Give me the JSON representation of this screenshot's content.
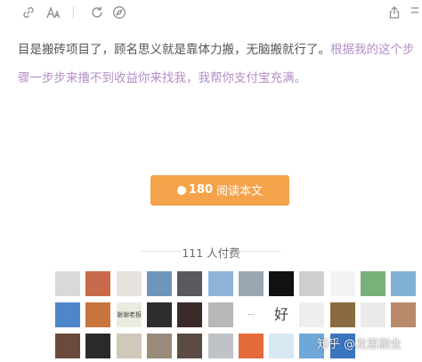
{
  "toolbar": {
    "icons": [
      {
        "name": "link-icon"
      },
      {
        "name": "font-size-icon"
      },
      {
        "name": "refresh-icon"
      },
      {
        "name": "compass-icon"
      },
      {
        "name": "share-icon"
      },
      {
        "name": "more-icon"
      }
    ]
  },
  "article": {
    "line1_text": "目是搬砖项目了，顾名思义就是靠体力搬，无脑搬就行了。",
    "line1_link": "根据我的这个步",
    "line2_link": "骤一步步来撸不到收益你来找我，我帮你支付宝充满。"
  },
  "read_button": {
    "count": "180",
    "label": "阅读本文"
  },
  "payers": {
    "label": "111 人付费"
  },
  "avatars": [
    {
      "bg": "#d9d9d9",
      "text": ""
    },
    {
      "bg": "#c86a4a",
      "text": ""
    },
    {
      "bg": "#e8e2dc",
      "text": ""
    },
    {
      "bg": "#6e96b8",
      "text": ""
    },
    {
      "bg": "#585a5e",
      "text": ""
    },
    {
      "bg": "#8fb4d8",
      "text": ""
    },
    {
      "bg": "#9aa7b2",
      "text": ""
    },
    {
      "bg": "#111111",
      "text": ""
    },
    {
      "bg": "#cfcfcf",
      "text": ""
    },
    {
      "bg": "#f3f3f3",
      "text": ""
    },
    {
      "bg": "#7ab07a",
      "text": ""
    },
    {
      "bg": "#7fb0d6",
      "text": ""
    },
    {
      "bg": "#4d86c9",
      "text": ""
    },
    {
      "bg": "#c9743e",
      "text": ""
    },
    {
      "bg": "#e8ede0",
      "text": "谢谢老板"
    },
    {
      "bg": "#2e2e2e",
      "text": ""
    },
    {
      "bg": "#3a2a2a",
      "text": ""
    },
    {
      "bg": "#b8b8b8",
      "text": ""
    },
    {
      "bg": "#ffffff",
      "text": "···"
    },
    {
      "bg": "#ffffff",
      "text": "好"
    },
    {
      "bg": "#eeeeee",
      "text": ""
    },
    {
      "bg": "#8a6b3f",
      "text": ""
    },
    {
      "bg": "#eaeaea",
      "text": ""
    },
    {
      "bg": "#b98a6a",
      "text": ""
    },
    {
      "bg": "#6a4a3a",
      "text": ""
    },
    {
      "bg": "#2a2a2a",
      "text": ""
    },
    {
      "bg": "#d0c8b8",
      "text": ""
    },
    {
      "bg": "#9a8a7a",
      "text": ""
    },
    {
      "bg": "#5a4a42",
      "text": ""
    },
    {
      "bg": "#bfc3c8",
      "text": ""
    },
    {
      "bg": "#e46a3a",
      "text": ""
    },
    {
      "bg": "#d8e8f2",
      "text": ""
    },
    {
      "bg": "#6fa7d8",
      "text": ""
    },
    {
      "bg": "#3a76c0",
      "text": ""
    }
  ],
  "watermark": "知乎 @龙崽副业",
  "colors": {
    "link": "#b48dc8",
    "button": "#f5a34b",
    "text": "#555555"
  }
}
